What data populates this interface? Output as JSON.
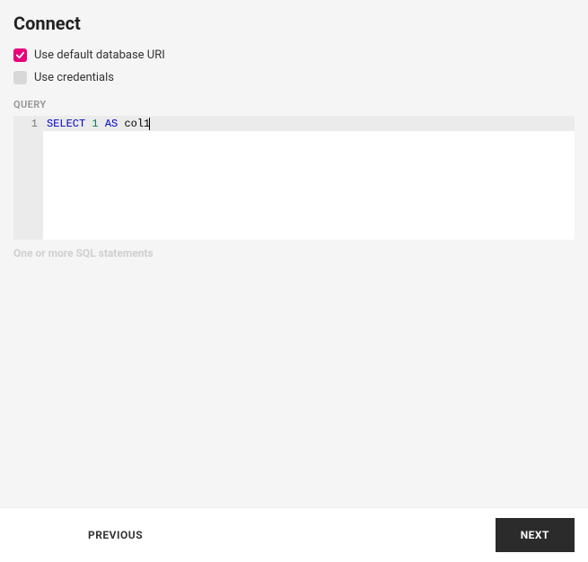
{
  "page_title": "Connect",
  "checkboxes": {
    "use_default_uri": {
      "label": "Use default database URI",
      "checked": true
    },
    "use_credentials": {
      "label": "Use credentials",
      "checked": false
    }
  },
  "query": {
    "section_label": "QUERY",
    "line_number": "1",
    "tokens": {
      "kw1": "SELECT",
      "num1": "1",
      "kw2": "AS",
      "ident1": "col1"
    },
    "hint": "One or more SQL statements"
  },
  "footer": {
    "previous": "PREVIOUS",
    "next": "NEXT"
  }
}
